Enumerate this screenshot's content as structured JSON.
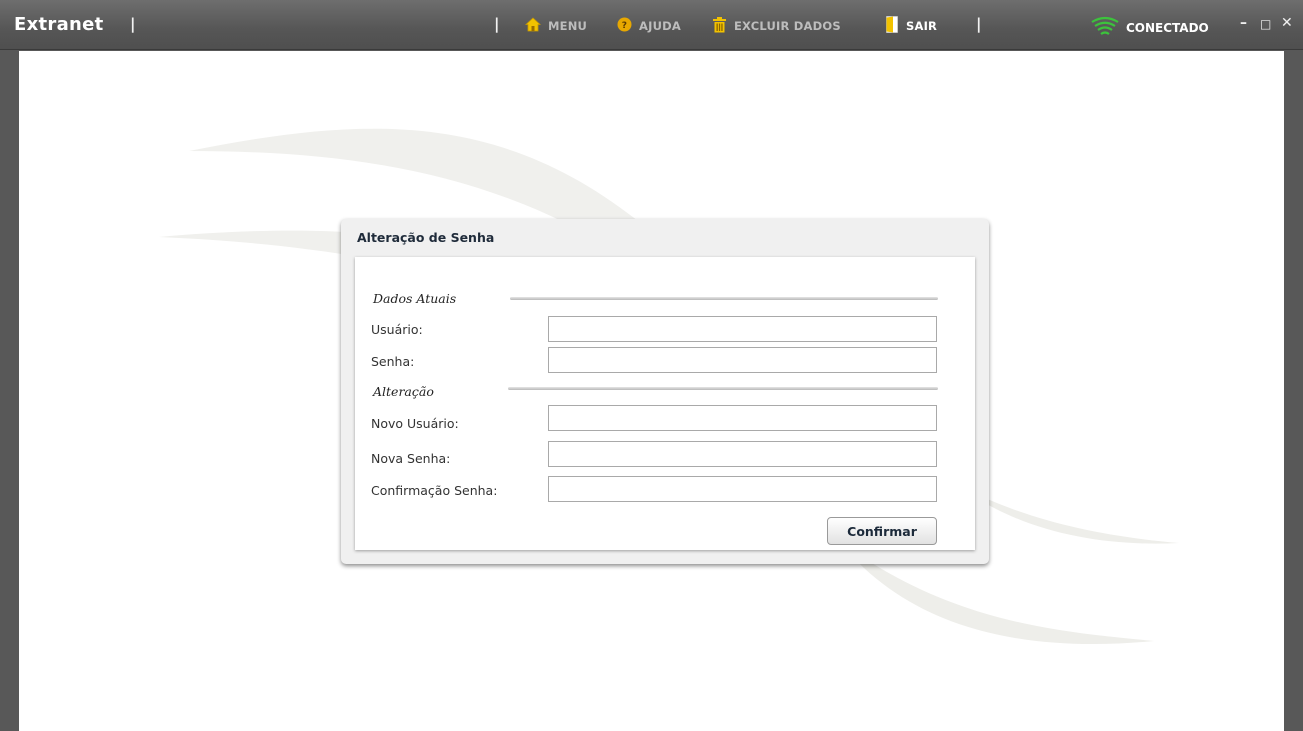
{
  "app": {
    "title": "Extranet"
  },
  "nav": {
    "separator": "|",
    "menu": {
      "label": "MENU",
      "icon": "home-icon"
    },
    "help": {
      "label": "AJUDA",
      "icon": "help-icon"
    },
    "delete_data": {
      "label": "EXCLUIR DADOS",
      "icon": "trash-icon"
    },
    "exit": {
      "label": "SAIR",
      "icon": "door-icon"
    }
  },
  "status": {
    "label": "CONECTADO",
    "icon": "wifi-signal-icon",
    "color": "#3cc33c"
  },
  "window_controls": {
    "minimize": "–",
    "maximize": "□",
    "close": "✕"
  },
  "form": {
    "title": "Alteração de Senha",
    "sections": {
      "current": "Dados Atuais",
      "change": "Alteração"
    },
    "fields": {
      "user": {
        "label": "Usuário:",
        "value": ""
      },
      "password": {
        "label": "Senha:",
        "value": ""
      },
      "new_user": {
        "label": "Novo Usuário:",
        "value": ""
      },
      "new_password": {
        "label": "Nova Senha:",
        "value": ""
      },
      "confirm_password": {
        "label": "Confirmação Senha:",
        "value": ""
      }
    },
    "confirm_label": "Confirmar"
  },
  "colors": {
    "titlebar": "#585858",
    "nav_icon": "#f2c200",
    "panel": "#f0f0f0"
  }
}
